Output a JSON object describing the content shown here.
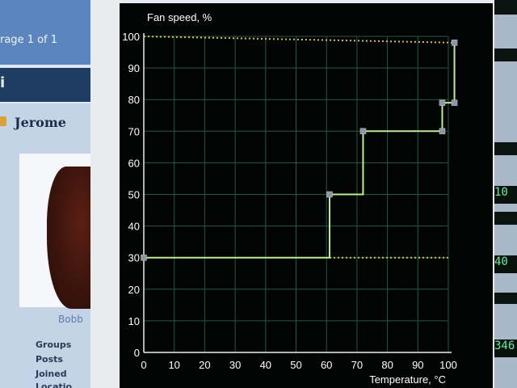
{
  "background_window": {
    "page_info": "rage 1 of 1",
    "header_text": "i",
    "username": "Jerome",
    "avatar_caption": "Bobb",
    "meta_labels": [
      "Groups",
      "Posts",
      "Joined",
      "Locatio"
    ]
  },
  "right_window": {
    "readouts": [
      "10",
      "40",
      "346"
    ]
  },
  "chart_data": {
    "type": "line",
    "ylabel": "Fan speed, %",
    "xlabel": "Temperature, °C",
    "xlim": [
      0,
      100
    ],
    "ylim": [
      0,
      100
    ],
    "xticks": [
      0,
      10,
      20,
      30,
      40,
      50,
      60,
      70,
      80,
      90,
      100
    ],
    "yticks": [
      0,
      10,
      20,
      30,
      40,
      50,
      60,
      70,
      80,
      90,
      100
    ],
    "grid": true,
    "series": [
      {
        "name": "",
        "color": "#b8f08a",
        "step": true,
        "points": [
          [
            0,
            30
          ],
          [
            61,
            30
          ],
          [
            61,
            50
          ],
          [
            72,
            50
          ],
          [
            72,
            70
          ],
          [
            98,
            70
          ],
          [
            98,
            79
          ],
          [
            102,
            79
          ],
          [
            102,
            98
          ]
        ],
        "markers": [
          [
            0,
            30
          ],
          [
            61,
            50
          ],
          [
            72,
            70
          ],
          [
            98,
            70
          ],
          [
            98,
            79
          ],
          [
            102,
            79
          ],
          [
            102,
            98
          ]
        ]
      }
    ],
    "reference_lines": [
      {
        "from": [
          0,
          100
        ],
        "to": [
          102,
          98
        ],
        "color": "#d9c23a",
        "style": "dotted"
      },
      {
        "from": [
          61,
          30
        ],
        "to": [
          100,
          30
        ],
        "color": "#d9c23a",
        "style": "dotted"
      }
    ],
    "colors": {
      "background": "#020403",
      "grid": "#1f5a43",
      "axis": "#e6f2e6",
      "label": "#ffffff"
    }
  }
}
